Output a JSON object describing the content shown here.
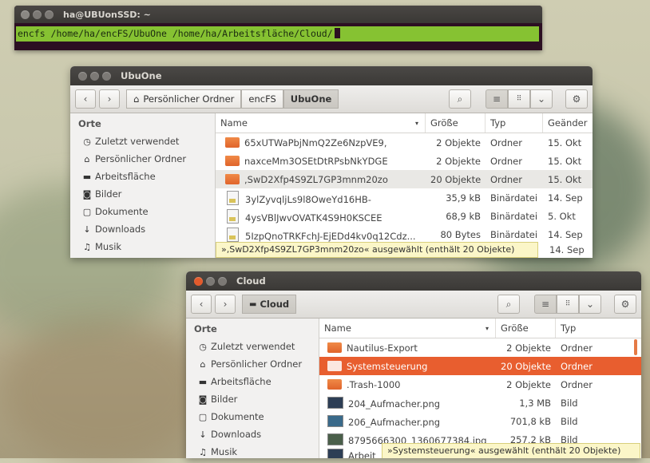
{
  "colors": {
    "accent": "#e85e2f",
    "terminal_green": "#86c232",
    "terminal_bg": "#2c0f22"
  },
  "terminal": {
    "title": "ha@UBUonSSD: ~",
    "command": "encfs /home/ha/encFS/UbuOne /home/ha/Arbeitsfläche/Cloud/"
  },
  "ubuone": {
    "title": "UbuOne",
    "breadcrumb": [
      "Persönlicher Ordner",
      "encFS",
      "UbuOne"
    ],
    "sidebar_title": "Orte",
    "sidebar": [
      "Zuletzt verwendet",
      "Persönlicher Ordner",
      "Arbeitsfläche",
      "Bilder",
      "Dokumente",
      "Downloads",
      "Musik"
    ],
    "columns": [
      "Name",
      "Größe",
      "Typ",
      "Geänder"
    ],
    "rows": [
      {
        "name": "65xUTWaPbjNmQ2Ze6NzpVE9,",
        "size": "2 Objekte",
        "type": "Ordner",
        "date": "15. Okt"
      },
      {
        "name": "naxceMm3OSEtDtRPsbNkYDGE",
        "size": "2 Objekte",
        "type": "Ordner",
        "date": "15. Okt"
      },
      {
        "name": ",SwD2Xfp4S9ZL7GP3mnm20zo",
        "size": "20 Objekte",
        "type": "Ordner",
        "date": "15. Okt"
      },
      {
        "name": "3ylZyvqljLs9l8OweYd16HB-",
        "size": "35,9 kB",
        "type": "Binärdatei",
        "date": "14. Sep"
      },
      {
        "name": "4ysVBlJwvOVATK4S9H0KSCEE",
        "size": "68,9 kB",
        "type": "Binärdatei",
        "date": "5. Okt"
      },
      {
        "name": "5IzpQnoTRKFchJ-EjEDd4kv0q12Cdz...",
        "size": "80 Bytes",
        "type": "Binärdatei",
        "date": "14. Sep"
      }
    ],
    "status": "»,SwD2Xfp4S9ZL7GP3mnm20zo« ausgewählt  (enthält 20 Objekte)",
    "status_date": "14. Sep"
  },
  "cloud": {
    "title": "Cloud",
    "breadcrumb": [
      "Cloud"
    ],
    "sidebar_title": "Orte",
    "sidebar": [
      "Zuletzt verwendet",
      "Persönlicher Ordner",
      "Arbeitsfläche",
      "Bilder",
      "Dokumente",
      "Downloads",
      "Musik"
    ],
    "columns": [
      "Name",
      "Größe",
      "Typ"
    ],
    "rows": [
      {
        "name": "Nautilus-Export",
        "size": "2 Objekte",
        "type": "Ordner",
        "icon": "folder-icon"
      },
      {
        "name": "Systemsteuerung",
        "size": "20 Objekte",
        "type": "Ordner",
        "icon": "folder-icon"
      },
      {
        "name": ".Trash-1000",
        "size": "2 Objekte",
        "type": "Ordner",
        "icon": "folder-icon"
      },
      {
        "name": "204_Aufmacher.png",
        "size": "1,3 MB",
        "type": "Bild",
        "icon": "image-icon"
      },
      {
        "name": "206_Aufmacher.png",
        "size": "701,8 kB",
        "type": "Bild",
        "icon": "image-icon"
      },
      {
        "name": "8795666300_1360677384.jpg",
        "size": "257,2 kB",
        "type": "Bild",
        "icon": "image-icon"
      },
      {
        "name": "Arbeit",
        "size": "",
        "type": "",
        "icon": "image-icon"
      }
    ],
    "status": "»Systemsteuerung« ausgewählt  (enthält 20 Objekte)"
  }
}
